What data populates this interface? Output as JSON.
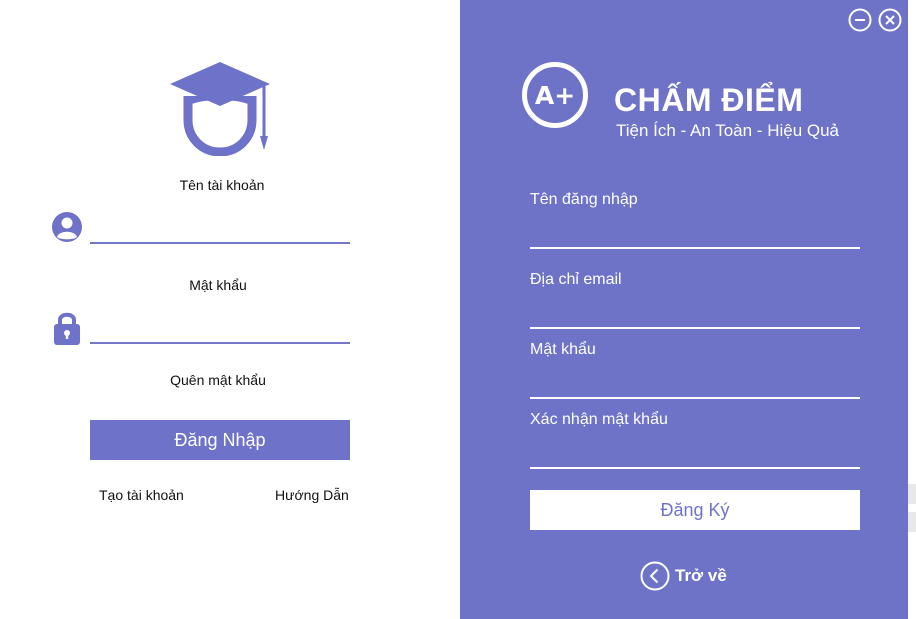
{
  "login": {
    "username_label": "Tên tài khoản",
    "password_label": "Mật khẩu",
    "forgot_label": "Quên mật khẩu",
    "login_button": "Đăng Nhập",
    "create_account": "Tạo tài khoản",
    "guide": "Hướng Dẫn"
  },
  "brand": {
    "badge": "A+",
    "title": "CHẤM ĐIỂM",
    "subtitle": "Tiện Ích - An Toàn - Hiệu Quả"
  },
  "register": {
    "username_label": "Tên đăng nhập",
    "email_label": "Địa chỉ email",
    "password_label": "Mật khẩu",
    "confirm_label": "Xác nhận mật khẩu",
    "register_button": "Đăng Ký",
    "back_label": "Trở về"
  },
  "colors": {
    "accent": "#6e73c8",
    "white": "#ffffff"
  },
  "icons": [
    "graduation-avatar-icon",
    "user-icon",
    "lock-icon",
    "minimize-icon",
    "close-icon",
    "back-chevron-icon"
  ]
}
